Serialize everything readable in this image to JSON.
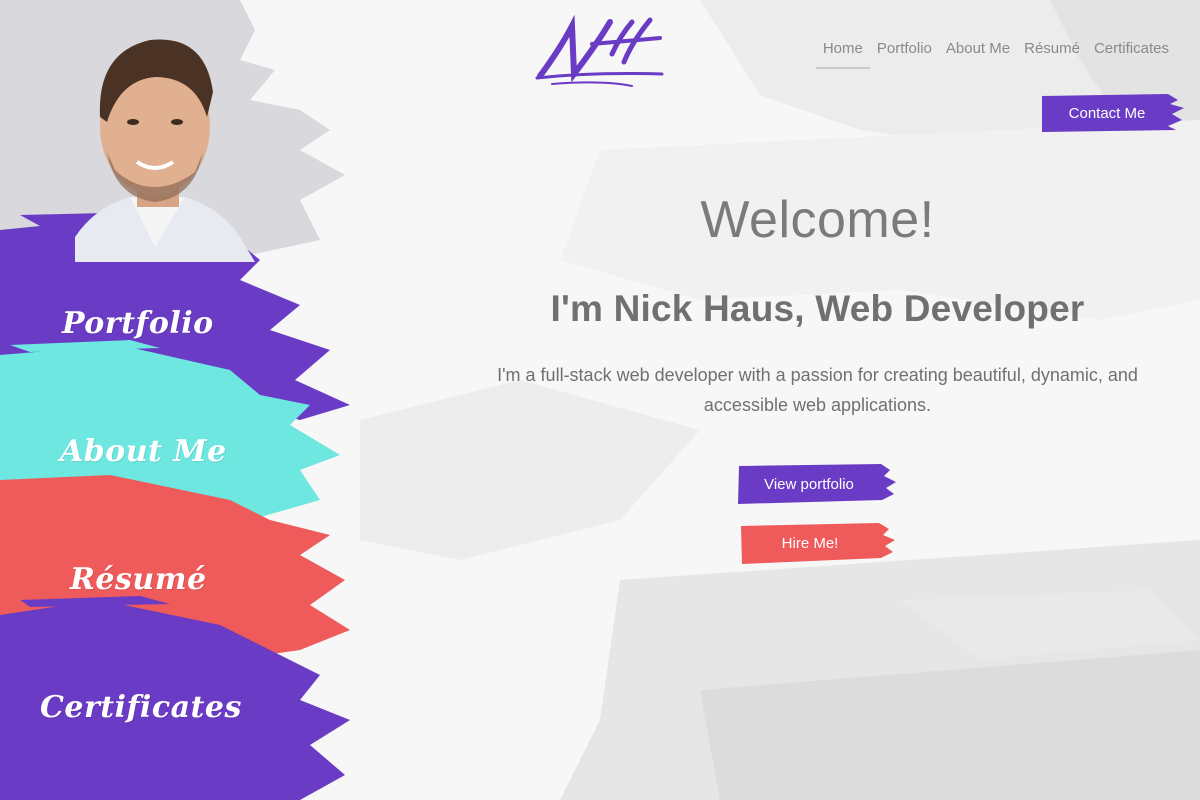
{
  "logo": {
    "text": "NH",
    "color": "#6a3bc4"
  },
  "nav": {
    "items": [
      {
        "label": "Home",
        "active": true
      },
      {
        "label": "Portfolio",
        "active": false
      },
      {
        "label": "About Me",
        "active": false
      },
      {
        "label": "Résumé",
        "active": false
      },
      {
        "label": "Certificates",
        "active": false
      }
    ],
    "contact_label": "Contact Me"
  },
  "sidebar": {
    "items": [
      {
        "label": "Portfolio",
        "color": "#6a3bc4"
      },
      {
        "label": "About Me",
        "color": "#6ee7e0"
      },
      {
        "label": "Résumé",
        "color": "#ef5a5a"
      },
      {
        "label": "Certificates",
        "color": "#6a3bc4"
      }
    ],
    "photo_bg": "#d9d8dd"
  },
  "hero": {
    "welcome": "Welcome!",
    "headline": "I'm Nick Haus, Web Developer",
    "tagline": "I'm a full-stack web developer with a passion for creating beautiful, dynamic, and accessible web applications.",
    "primary_cta": "View portfolio",
    "secondary_cta": "Hire Me!"
  },
  "colors": {
    "purple": "#6a3bc4",
    "teal": "#6ee7e0",
    "coral": "#ef5a5a",
    "text_gray": "#707070"
  }
}
